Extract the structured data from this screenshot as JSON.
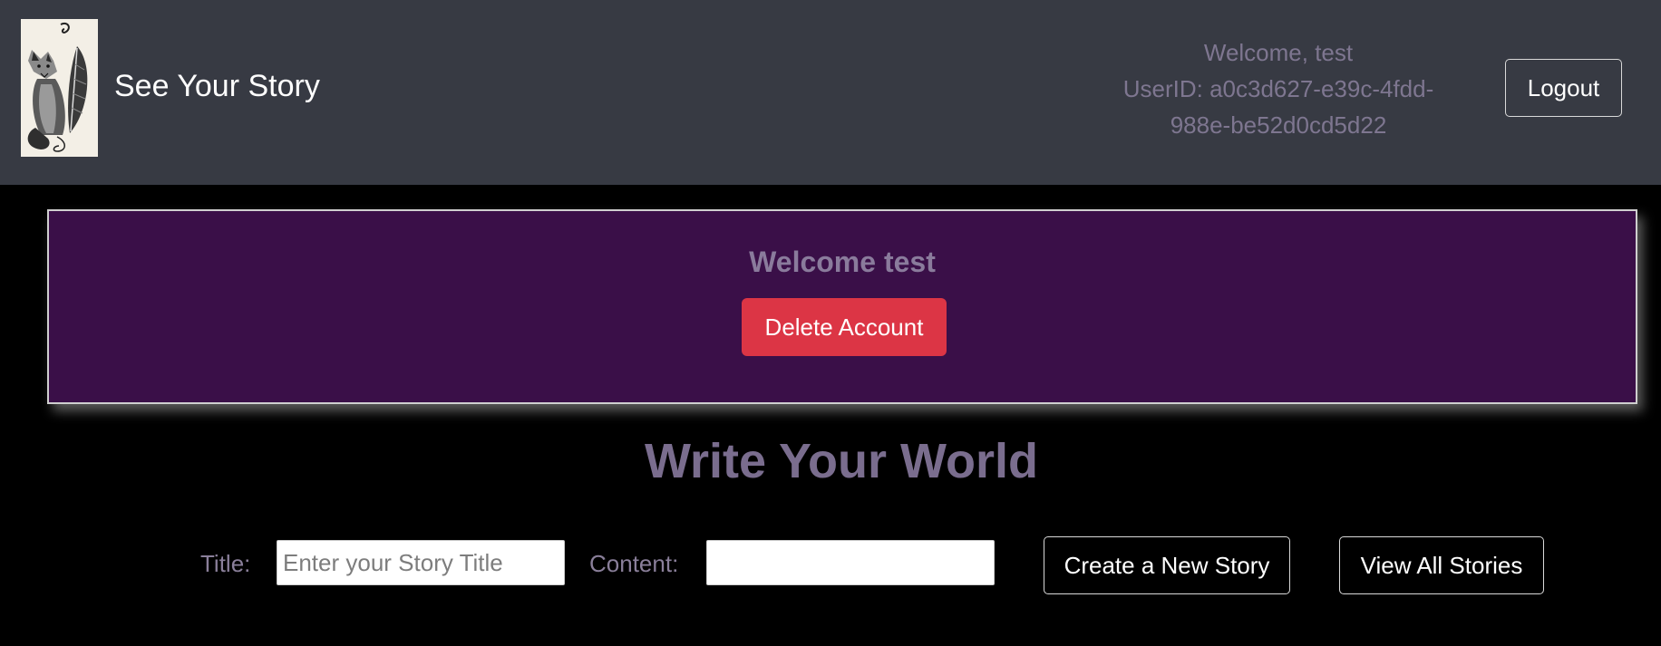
{
  "navbar": {
    "brand": "See Your Story",
    "logo_icon": "fox-quill-logo-icon",
    "welcome_text": "Welcome, test",
    "userid_line1": "UserID: a0c3d627-e39c-4fdd-",
    "userid_line2": "988e-be52d0cd5d22",
    "logout_label": "Logout"
  },
  "welcome_card": {
    "heading": "Welcome test",
    "delete_label": "Delete Account",
    "delete_color": "#dc3545",
    "background": "#3a0f48"
  },
  "main": {
    "title": "Write Your World",
    "form": {
      "title_label": "Title:",
      "title_placeholder": "Enter your Story Title",
      "title_value": "",
      "content_label": "Content:",
      "content_placeholder": "",
      "content_value": "",
      "create_label": "Create a New Story",
      "view_label": "View All Stories"
    }
  }
}
